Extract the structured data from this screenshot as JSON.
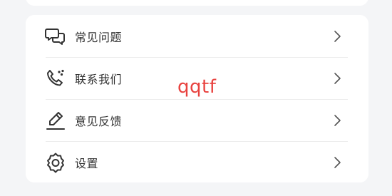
{
  "menu": {
    "items": [
      {
        "label": "常见问题",
        "icon": "chat-bubbles-icon"
      },
      {
        "label": "联系我们",
        "icon": "phone-call-icon"
      },
      {
        "label": "意见反馈",
        "icon": "pencil-edit-icon"
      },
      {
        "label": "设置",
        "icon": "gear-icon"
      }
    ]
  },
  "overlay": {
    "text": "qqtf"
  },
  "colors": {
    "background": "#f4f5f7",
    "card": "#ffffff",
    "text": "#333333",
    "icon": "#333333",
    "overlay": "#e8423f"
  }
}
